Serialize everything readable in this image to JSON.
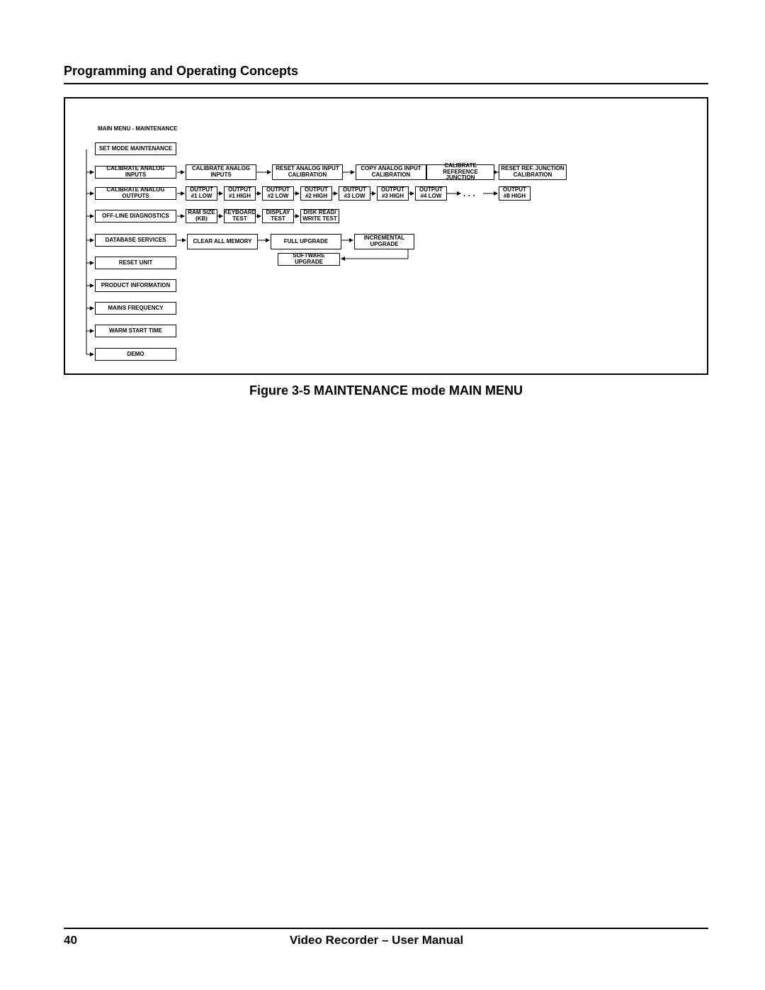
{
  "header": {
    "section_title": "Programming and Operating Concepts"
  },
  "figure": {
    "caption": "Figure 3-5   MAINTENANCE mode MAIN MENU",
    "breadcrumb": "MAIN MENU  -  MAINTENANCE",
    "root": "SET MODE     MAINTENANCE",
    "menu": [
      "CALIBRATE ANALOG INPUTS",
      "CALIBRATE ANALOG OUTPUTS",
      "OFF-LINE DIAGNOSTICS",
      "DATABASE SERVICES",
      "RESET UNIT",
      "PRODUCT INFORMATION",
      "MAINS FREQUENCY",
      "WARM START TIME",
      "DEMO"
    ],
    "row_a": [
      "CALIBRATE ANALOG INPUTS",
      "RESET ANALOG INPUT CALIBRATION",
      "COPY ANALOG INPUT CALIBRATION",
      "CALIBRATE REFERENCE JUNCTION",
      "RESET REF. JUNCTION CALIBRATION"
    ],
    "row_b": [
      "OUTPUT #1 LOW",
      "OUTPUT #1 HIGH",
      "OUTPUT #2 LOW",
      "OUTPUT #2 HIGH",
      "OUTPUT #3 LOW",
      "OUTPUT #3 HIGH",
      "OUTPUT #4 LOW"
    ],
    "row_b_last": "OUTPUT #8 HIGH",
    "dots": ". . .",
    "row_c": [
      "RAM SIZE (KB)",
      "KEYBOARD TEST",
      "DISPLAY TEST",
      "DISK READ/ WRITE TEST"
    ],
    "row_d": [
      "CLEAR ALL MEMORY",
      "FULL UPGRADE",
      "INCREMENTAL UPGRADE"
    ],
    "row_d_extra": "SOFTWARE UPGRADE"
  },
  "footer": {
    "page_number": "40",
    "doc_title": "Video Recorder – User Manual"
  }
}
